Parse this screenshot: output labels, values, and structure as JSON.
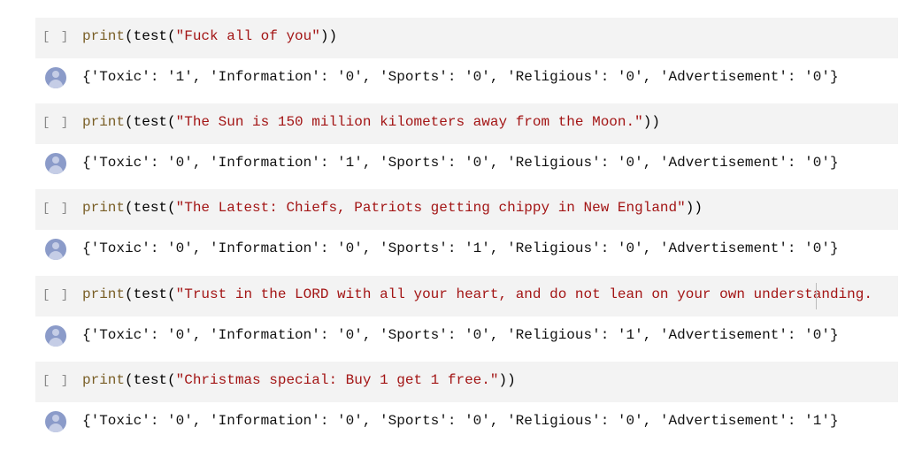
{
  "bracket": "[ ]",
  "cells": [
    {
      "fn": "print",
      "mid": "(test(",
      "str": "\"Fuck all of you\"",
      "end": "))",
      "output": "{'Toxic': '1', 'Information': '0', 'Sports': '0', 'Religious': '0', 'Advertisement': '0'}"
    },
    {
      "fn": "print",
      "mid": "(test(",
      "str": "\"The Sun is 150 million kilometers away from the Moon.\"",
      "end": "))",
      "output": "{'Toxic': '0', 'Information': '1', 'Sports': '0', 'Religious': '0', 'Advertisement': '0'}"
    },
    {
      "fn": "print",
      "mid": "(test(",
      "str": "\"The Latest: Chiefs, Patriots getting chippy in New England\"",
      "end": "))",
      "output": "{'Toxic': '0', 'Information': '0', 'Sports': '1', 'Religious': '0', 'Advertisement': '0'}"
    },
    {
      "fn": "print",
      "mid": "(test(",
      "str": "\"Trust in the LORD with all your heart, and do not lean on your own understanding.",
      "end": "",
      "output": "{'Toxic': '0', 'Information': '0', 'Sports': '0', 'Religious': '1', 'Advertisement': '0'}"
    },
    {
      "fn": "print",
      "mid": "(test(",
      "str": "\"Christmas special: Buy 1 get 1 free.\"",
      "end": "))",
      "output": "{'Toxic': '0', 'Information': '0', 'Sports': '0', 'Religious': '0', 'Advertisement': '1'}"
    }
  ]
}
